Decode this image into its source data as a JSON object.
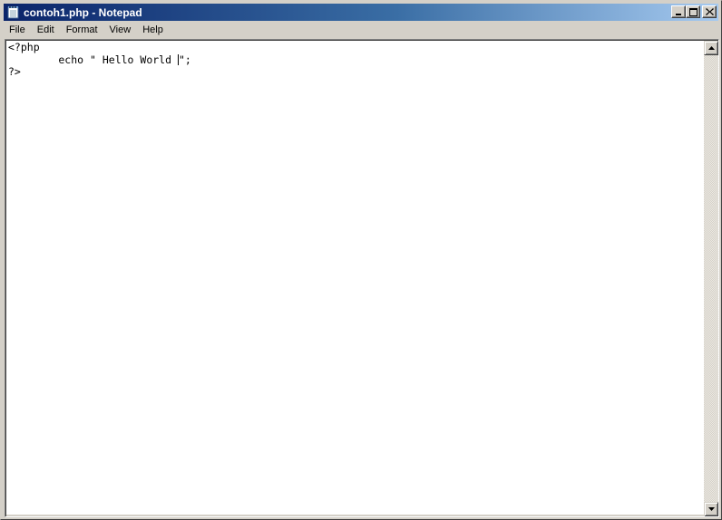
{
  "window": {
    "title": "contoh1.php - Notepad"
  },
  "icons": {
    "app": "notepad-icon",
    "minimize": "minimize-icon",
    "maximize": "maximize-icon",
    "close": "close-icon",
    "scroll_up": "arrow-up-icon",
    "scroll_down": "arrow-down-icon"
  },
  "colors": {
    "titlebar_start": "#0a246a",
    "titlebar_end": "#a6caf0",
    "chrome": "#d4d0c8",
    "editor_bg": "#ffffff"
  },
  "menu": {
    "items": [
      {
        "label": "File"
      },
      {
        "label": "Edit"
      },
      {
        "label": "Format"
      },
      {
        "label": "View"
      },
      {
        "label": "Help"
      }
    ]
  },
  "editor": {
    "lines": [
      "<?php",
      "        echo \" Hello World ",
      "\";",
      "?>"
    ]
  }
}
